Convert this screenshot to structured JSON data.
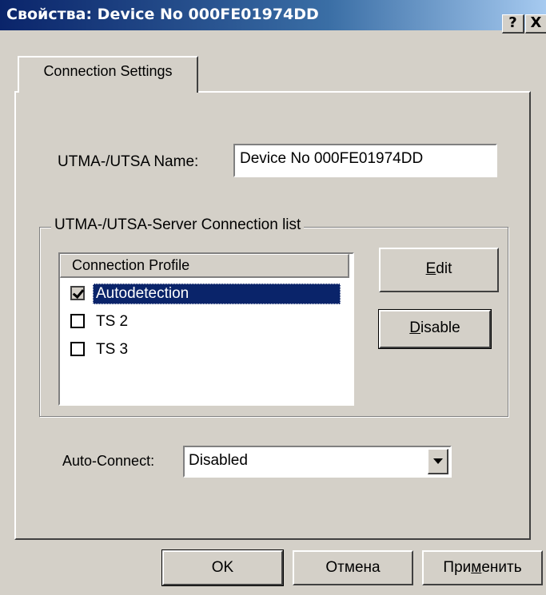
{
  "window": {
    "title": "Свойства: Device No  000FE01974DD",
    "help_label": "?",
    "close_label": "X"
  },
  "tabs": [
    {
      "label": "Connection Settings",
      "active": true
    }
  ],
  "name_field": {
    "label": "UTMA-/UTSA Name:",
    "value": "Device No  000FE01974DD"
  },
  "connection_group": {
    "title": "UTMA-/UTSA-Server Connection list",
    "column_header": "Connection Profile",
    "items": [
      {
        "label": "Autodetection",
        "checked": true,
        "selected": true
      },
      {
        "label": "TS 2",
        "checked": false,
        "selected": false
      },
      {
        "label": "TS 3",
        "checked": false,
        "selected": false
      }
    ],
    "edit_button": {
      "mnemonic": "E",
      "rest": "dit"
    },
    "disable_button": {
      "mnemonic": "D",
      "rest": "isable"
    }
  },
  "auto_connect": {
    "label": "Auto-Connect:",
    "value": "Disabled"
  },
  "footer": {
    "ok_label": "OK",
    "cancel_label": "Отмена",
    "apply_label_pre": "При",
    "apply_label_mnemonic": "м",
    "apply_label_post": "енить"
  }
}
